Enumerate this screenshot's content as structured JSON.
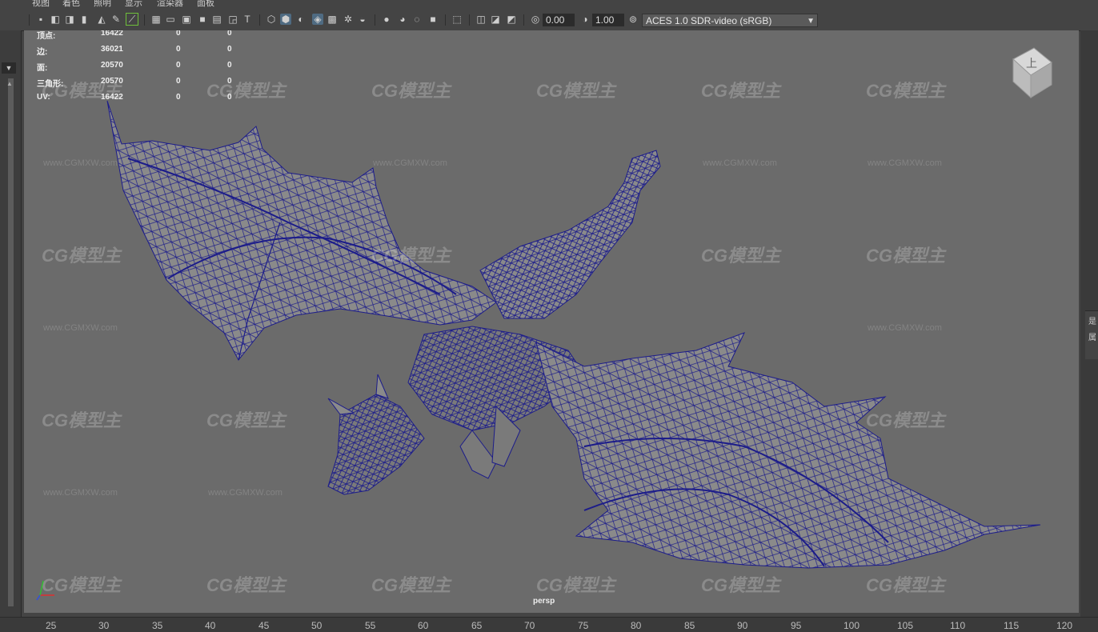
{
  "menu": [
    "视图",
    "着色",
    "照明",
    "显示",
    "渲染器",
    "面板"
  ],
  "toolbar": {
    "exposure_value": "0.00",
    "gamma_value": "1.00",
    "color_management": "ACES 1.0 SDR-video (sRGB)"
  },
  "hud": {
    "rows": [
      {
        "label": "顶点:",
        "v1": "16422",
        "v2": "0",
        "v3": "0"
      },
      {
        "label": "边:",
        "v1": "36021",
        "v2": "0",
        "v3": "0"
      },
      {
        "label": "面:",
        "v1": "20570",
        "v2": "0",
        "v3": "0"
      },
      {
        "label": "三角形:",
        "v1": "20570",
        "v2": "0",
        "v3": "0"
      },
      {
        "label": "UV:",
        "v1": "16422",
        "v2": "0",
        "v3": "0"
      }
    ]
  },
  "viewport": {
    "camera": "persp",
    "viewcube_face": "上",
    "wireframe_color": "#1c1c8a",
    "background_color": "#6b6b6b"
  },
  "watermark": {
    "brand": "CG模型主",
    "url": "www.CGMXW.com"
  },
  "right_panel": {
    "chars": [
      "是",
      "属"
    ]
  },
  "ruler": {
    "ticks": [
      "25",
      "30",
      "35",
      "40",
      "45",
      "50",
      "55",
      "60",
      "65",
      "70",
      "75",
      "80",
      "85",
      "90",
      "95",
      "100",
      "105",
      "110",
      "115",
      "120"
    ]
  }
}
